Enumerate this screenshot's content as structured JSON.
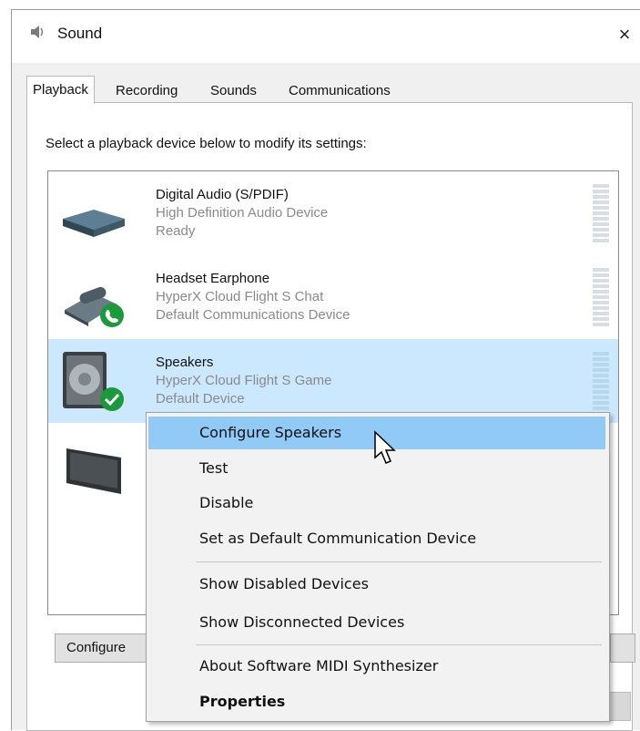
{
  "window": {
    "title": "Sound",
    "close_label": "×"
  },
  "tabs": [
    {
      "label": "Playback"
    },
    {
      "label": "Recording"
    },
    {
      "label": "Sounds"
    },
    {
      "label": "Communications"
    }
  ],
  "instruction": "Select a playback device below to modify its settings:",
  "devices": [
    {
      "name": "Digital Audio (S/PDIF)",
      "description": "High Definition Audio Device",
      "status": "Ready",
      "icon": "spdif-device-icon"
    },
    {
      "name": "Headset Earphone",
      "description": "HyperX Cloud Flight S Chat",
      "status": "Default Communications Device",
      "icon": "headset-phone-icon"
    },
    {
      "name": "Speakers",
      "description": "HyperX Cloud Flight S Game",
      "status": "Default Device",
      "icon": "speaker-icon"
    },
    {
      "name": "",
      "description": "",
      "status": "",
      "icon": "monitor-icon"
    }
  ],
  "buttons": {
    "configure": "Configure"
  },
  "context_menu": {
    "items": [
      {
        "label": "Configure Speakers"
      },
      {
        "label": "Test"
      },
      {
        "label": "Disable"
      },
      {
        "label": "Set as Default Communication Device"
      },
      {
        "label": "Show Disabled Devices"
      },
      {
        "label": "Show Disconnected Devices"
      },
      {
        "label": "About Software MIDI Synthesizer"
      },
      {
        "label": "Properties"
      }
    ]
  },
  "colors": {
    "selection": "#cce8ff",
    "menu_highlight": "#91c9f7",
    "default_check": "#1a9a3a"
  }
}
